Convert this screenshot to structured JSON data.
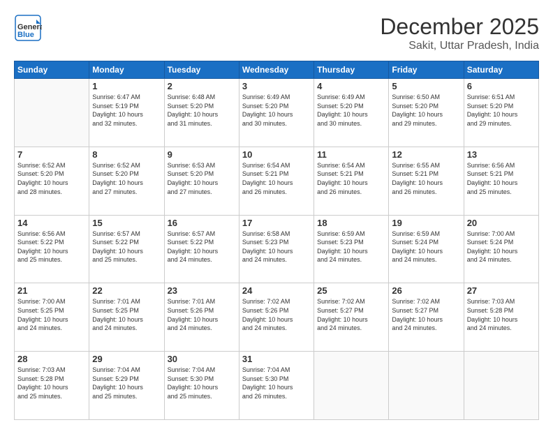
{
  "header": {
    "logo_general": "General",
    "logo_blue": "Blue",
    "month": "December 2025",
    "location": "Sakit, Uttar Pradesh, India"
  },
  "days_of_week": [
    "Sunday",
    "Monday",
    "Tuesday",
    "Wednesday",
    "Thursday",
    "Friday",
    "Saturday"
  ],
  "weeks": [
    [
      {
        "day": "",
        "info": ""
      },
      {
        "day": "1",
        "info": "Sunrise: 6:47 AM\nSunset: 5:19 PM\nDaylight: 10 hours\nand 32 minutes."
      },
      {
        "day": "2",
        "info": "Sunrise: 6:48 AM\nSunset: 5:20 PM\nDaylight: 10 hours\nand 31 minutes."
      },
      {
        "day": "3",
        "info": "Sunrise: 6:49 AM\nSunset: 5:20 PM\nDaylight: 10 hours\nand 30 minutes."
      },
      {
        "day": "4",
        "info": "Sunrise: 6:49 AM\nSunset: 5:20 PM\nDaylight: 10 hours\nand 30 minutes."
      },
      {
        "day": "5",
        "info": "Sunrise: 6:50 AM\nSunset: 5:20 PM\nDaylight: 10 hours\nand 29 minutes."
      },
      {
        "day": "6",
        "info": "Sunrise: 6:51 AM\nSunset: 5:20 PM\nDaylight: 10 hours\nand 29 minutes."
      }
    ],
    [
      {
        "day": "7",
        "info": "Sunrise: 6:52 AM\nSunset: 5:20 PM\nDaylight: 10 hours\nand 28 minutes."
      },
      {
        "day": "8",
        "info": "Sunrise: 6:52 AM\nSunset: 5:20 PM\nDaylight: 10 hours\nand 27 minutes."
      },
      {
        "day": "9",
        "info": "Sunrise: 6:53 AM\nSunset: 5:20 PM\nDaylight: 10 hours\nand 27 minutes."
      },
      {
        "day": "10",
        "info": "Sunrise: 6:54 AM\nSunset: 5:21 PM\nDaylight: 10 hours\nand 26 minutes."
      },
      {
        "day": "11",
        "info": "Sunrise: 6:54 AM\nSunset: 5:21 PM\nDaylight: 10 hours\nand 26 minutes."
      },
      {
        "day": "12",
        "info": "Sunrise: 6:55 AM\nSunset: 5:21 PM\nDaylight: 10 hours\nand 26 minutes."
      },
      {
        "day": "13",
        "info": "Sunrise: 6:56 AM\nSunset: 5:21 PM\nDaylight: 10 hours\nand 25 minutes."
      }
    ],
    [
      {
        "day": "14",
        "info": "Sunrise: 6:56 AM\nSunset: 5:22 PM\nDaylight: 10 hours\nand 25 minutes."
      },
      {
        "day": "15",
        "info": "Sunrise: 6:57 AM\nSunset: 5:22 PM\nDaylight: 10 hours\nand 25 minutes."
      },
      {
        "day": "16",
        "info": "Sunrise: 6:57 AM\nSunset: 5:22 PM\nDaylight: 10 hours\nand 24 minutes."
      },
      {
        "day": "17",
        "info": "Sunrise: 6:58 AM\nSunset: 5:23 PM\nDaylight: 10 hours\nand 24 minutes."
      },
      {
        "day": "18",
        "info": "Sunrise: 6:59 AM\nSunset: 5:23 PM\nDaylight: 10 hours\nand 24 minutes."
      },
      {
        "day": "19",
        "info": "Sunrise: 6:59 AM\nSunset: 5:24 PM\nDaylight: 10 hours\nand 24 minutes."
      },
      {
        "day": "20",
        "info": "Sunrise: 7:00 AM\nSunset: 5:24 PM\nDaylight: 10 hours\nand 24 minutes."
      }
    ],
    [
      {
        "day": "21",
        "info": "Sunrise: 7:00 AM\nSunset: 5:25 PM\nDaylight: 10 hours\nand 24 minutes."
      },
      {
        "day": "22",
        "info": "Sunrise: 7:01 AM\nSunset: 5:25 PM\nDaylight: 10 hours\nand 24 minutes."
      },
      {
        "day": "23",
        "info": "Sunrise: 7:01 AM\nSunset: 5:26 PM\nDaylight: 10 hours\nand 24 minutes."
      },
      {
        "day": "24",
        "info": "Sunrise: 7:02 AM\nSunset: 5:26 PM\nDaylight: 10 hours\nand 24 minutes."
      },
      {
        "day": "25",
        "info": "Sunrise: 7:02 AM\nSunset: 5:27 PM\nDaylight: 10 hours\nand 24 minutes."
      },
      {
        "day": "26",
        "info": "Sunrise: 7:02 AM\nSunset: 5:27 PM\nDaylight: 10 hours\nand 24 minutes."
      },
      {
        "day": "27",
        "info": "Sunrise: 7:03 AM\nSunset: 5:28 PM\nDaylight: 10 hours\nand 24 minutes."
      }
    ],
    [
      {
        "day": "28",
        "info": "Sunrise: 7:03 AM\nSunset: 5:28 PM\nDaylight: 10 hours\nand 25 minutes."
      },
      {
        "day": "29",
        "info": "Sunrise: 7:04 AM\nSunset: 5:29 PM\nDaylight: 10 hours\nand 25 minutes."
      },
      {
        "day": "30",
        "info": "Sunrise: 7:04 AM\nSunset: 5:30 PM\nDaylight: 10 hours\nand 25 minutes."
      },
      {
        "day": "31",
        "info": "Sunrise: 7:04 AM\nSunset: 5:30 PM\nDaylight: 10 hours\nand 26 minutes."
      },
      {
        "day": "",
        "info": ""
      },
      {
        "day": "",
        "info": ""
      },
      {
        "day": "",
        "info": ""
      }
    ]
  ]
}
